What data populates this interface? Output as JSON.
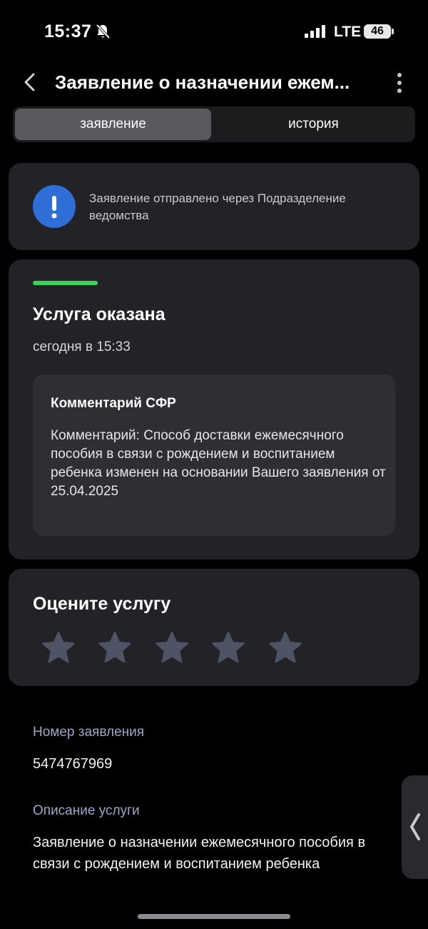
{
  "status_bar": {
    "time": "15:37",
    "network": "LTE",
    "battery": "46",
    "icons": [
      "bell-slash-icon",
      "signal-icon"
    ]
  },
  "header": {
    "title": "Заявление о назначении ежем...",
    "back_icon": "chevron-left-icon",
    "more_icon": "more-vertical-icon"
  },
  "tabs": [
    {
      "label": "заявление",
      "selected": true
    },
    {
      "label": "история",
      "selected": false
    }
  ],
  "info_card": {
    "icon": "exclamation-icon",
    "icon_color": "#2f6ed6",
    "text": "Заявление отправлено через Подразделение ведомства"
  },
  "status_card": {
    "accent_color": "#3ad45b",
    "title": "Услуга оказана",
    "date": "сегодня в 15:33",
    "comment": {
      "title": "Комментарий СФР",
      "text": "Комментарий: Способ доставки ежемесячного пособия в связи с рождением и воспитанием ребенка изменен на основании Вашего заявления от 25.04.2025"
    }
  },
  "rating_card": {
    "title": "Оцените услугу",
    "max_stars": 5,
    "selected_stars": 0,
    "star_color": "#4f5366"
  },
  "details": {
    "number_label": "Номер заявления",
    "number_value": "5474767969",
    "description_label": "Описание услуги",
    "description_value": "Заявление о назначении ежемесячного пособия в связи с рождением и воспитанием ребенка"
  }
}
